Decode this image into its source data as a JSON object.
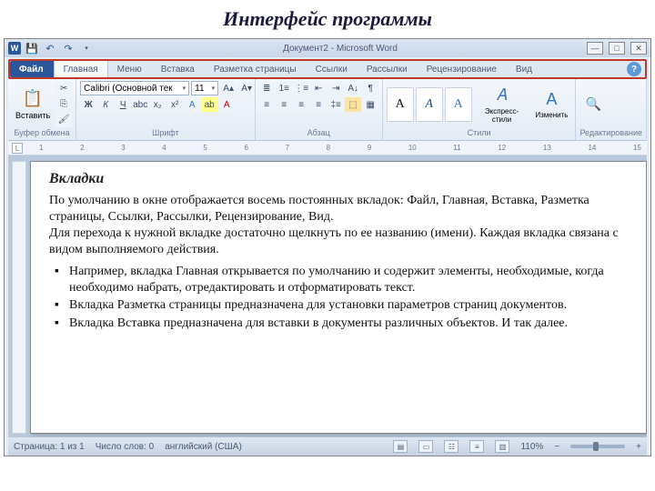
{
  "slide_title": "Интерфейс программы",
  "titlebar": {
    "app_badge": "W",
    "doc_title": "Документ2 - Microsoft Word"
  },
  "qat": {
    "save": "💾",
    "undo": "↶",
    "redo": "↷",
    "dd": "▾"
  },
  "winctrl": {
    "min": "—",
    "max": "□",
    "close": "✕"
  },
  "tabs": {
    "file": "Файл",
    "items": [
      "Главная",
      "Меню",
      "Вставка",
      "Разметка страницы",
      "Ссылки",
      "Рассылки",
      "Рецензирование",
      "Вид"
    ],
    "help": "?"
  },
  "ribbon": {
    "clipboard": {
      "paste": "📋",
      "paste_lbl": "Вставить",
      "label": "Буфер обмена"
    },
    "font": {
      "name": "Calibri (Основной тек",
      "size": "11",
      "label": "Шрифт"
    },
    "para": {
      "label": "Абзац"
    },
    "styles": {
      "express": "Экспресс-стили",
      "change": "Изменить",
      "label": "Стили"
    },
    "editing": {
      "label": "Редактирование"
    }
  },
  "ruler": {
    "L": "L",
    "ticks": [
      "1",
      "2",
      "3",
      "4",
      "5",
      "6",
      "7",
      "8",
      "9",
      "10",
      "11",
      "12",
      "13",
      "14",
      "15"
    ]
  },
  "doc": {
    "h": "Вкладки",
    "p1": "По умолчанию в окне отображается восемь постоянных вкладок: Файл,   Главная,   Вставка,   Разметка страницы,   Ссылки,   Рассылки,   Рецензирование,   Вид.",
    "p2": "Для перехода к нужной вкладке достаточно щелкнуть по ее названию (имени). Каждая вкладка связана с видом выполняемого действия.",
    "li1": "Например, вкладка Главная открывается по умолчанию  и содержит элементы, необходимые, когда необходимо набрать, отредактировать и отформатировать текст.",
    "li2": "Вкладка Разметка страницы предназначена для установки параметров страниц документов.",
    "li3": " Вкладка Вставка предназначена для вставки в документы различных объектов. И так далее."
  },
  "status": {
    "page": "Страница: 1 из 1",
    "words": "Число слов: 0",
    "lang": "английский (США)",
    "zoom": "110%",
    "minus": "−",
    "plus": "+"
  }
}
